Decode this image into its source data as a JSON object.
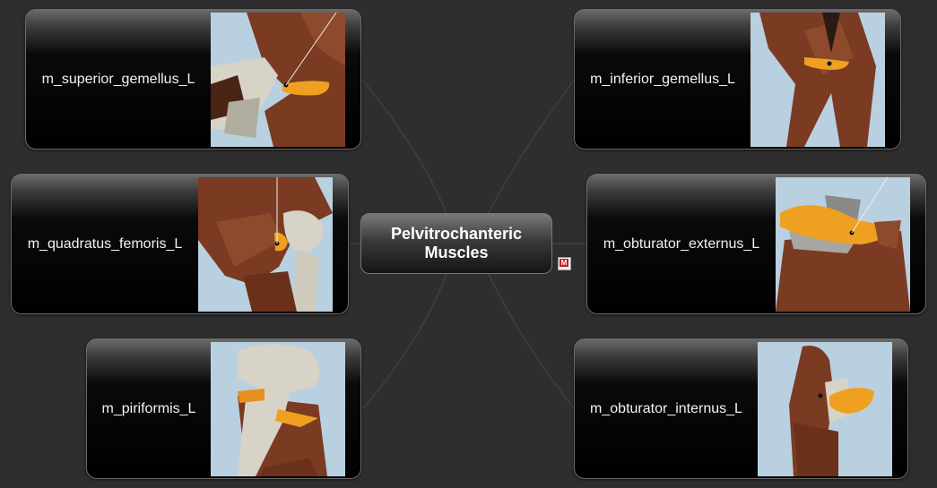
{
  "center": {
    "line1": "Pelvitrochanteric",
    "line2": "Muscles"
  },
  "center_attachment_icon": "mindmap-attachment-icon",
  "nodes": [
    {
      "label": "m_superior_gemellus_L"
    },
    {
      "label": "m_quadratus_femoris_L"
    },
    {
      "label": "m_piriformis_L"
    },
    {
      "label": "m_inferior_gemellus_L"
    },
    {
      "label": "m_obturator_externus_L"
    },
    {
      "label": "m_obturator_internus_L"
    }
  ],
  "colors": {
    "background": "#2e2e2e",
    "muscle": "#7b3a22",
    "highlight": "#f0a020",
    "bone": "#d7d3c6",
    "thumb_bg": "#b9d0e0"
  }
}
